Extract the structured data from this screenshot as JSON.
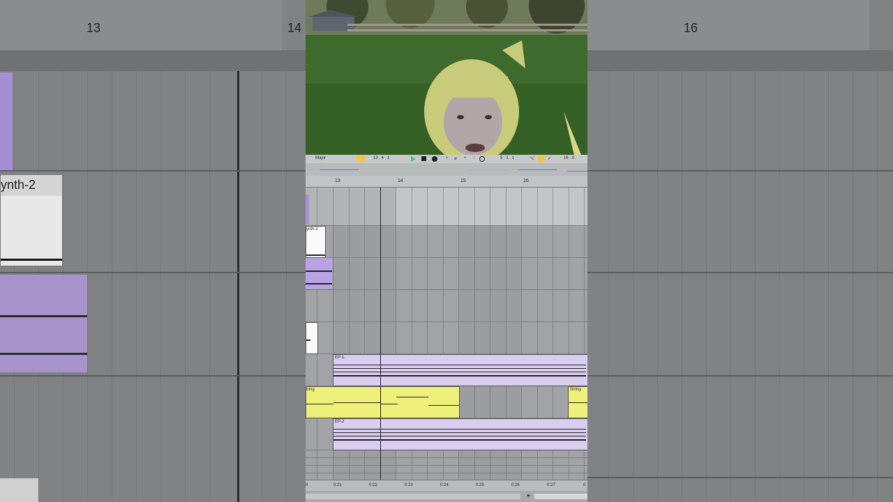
{
  "left_bg": {
    "ruler_label": "13",
    "ruler_label_right": "14",
    "track_label": "ynth-2"
  },
  "right_bg": {
    "ruler_label": "16"
  },
  "toolbar": {
    "scale": "Major",
    "position": "13 .  4 .  1",
    "loop_length": "5 .  1 .  1",
    "end_position": "16 .  0 ."
  },
  "ruler": {
    "bars": [
      "13",
      "14",
      "15",
      "16"
    ]
  },
  "clips": {
    "synth_label": "ynth-2",
    "ep1_label": "EP-1.",
    "string_label_a": "tring",
    "string_label_b": "String",
    "ep2_label": "EP-2"
  },
  "timeline": {
    "times": [
      "0",
      "0:21",
      "0:22",
      "0:23",
      "0:24",
      "0:25",
      "0:26",
      "0:27",
      "0"
    ]
  },
  "colors": {
    "purple_clip": "#d9cdf0",
    "purple_dark": "#a98fd6",
    "yellow_clip": "#eef07a",
    "loop_yellow": "#f3c53c",
    "play_green": "#3cc86e"
  }
}
